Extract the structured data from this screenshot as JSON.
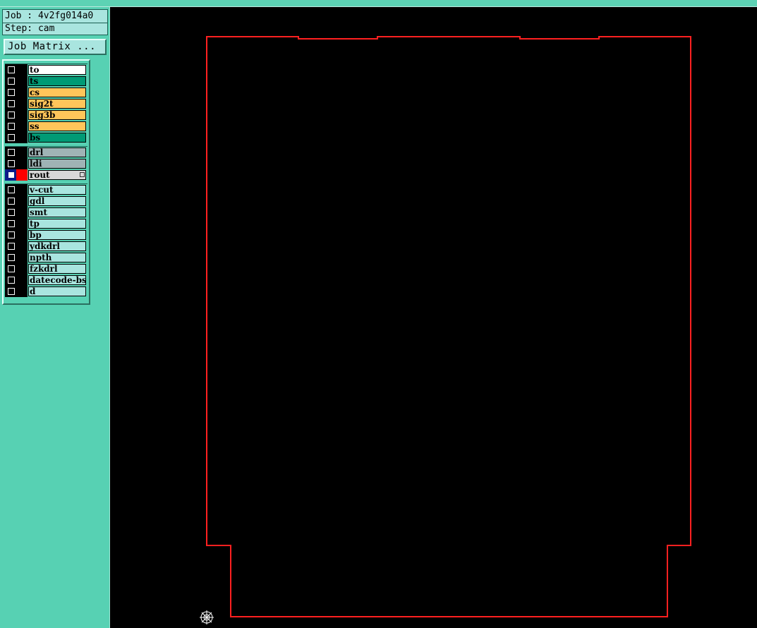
{
  "job": {
    "job_line": "Job : 4v2fg014a0",
    "step_line": "Step: cam"
  },
  "toolbar": {
    "job_matrix_label": "Job Matrix ..."
  },
  "layers": {
    "board": [
      {
        "name": "to",
        "color": "#ffffff"
      },
      {
        "name": "ts",
        "color": "#009a75"
      },
      {
        "name": "cs",
        "color": "#ffc55a"
      },
      {
        "name": "sig2t",
        "color": "#ffc55a"
      },
      {
        "name": "sig3b",
        "color": "#ffc55a"
      },
      {
        "name": "ss",
        "color": "#ffc55a"
      },
      {
        "name": "bs",
        "color": "#009a75"
      }
    ],
    "drill": [
      {
        "name": "drl",
        "color": "#9fb3b5"
      },
      {
        "name": "ldi",
        "color": "#9fb3b5"
      },
      {
        "name": "rout",
        "color": "#d8d8d8"
      }
    ],
    "misc": [
      {
        "name": "v-cut",
        "color": "#a9e5df"
      },
      {
        "name": "gdl",
        "color": "#a9e5df"
      },
      {
        "name": "smt",
        "color": "#a9e5df"
      },
      {
        "name": "tp",
        "color": "#a9e5df"
      },
      {
        "name": "bp",
        "color": "#a9e5df"
      },
      {
        "name": "ydkdrl",
        "color": "#a9e5df"
      },
      {
        "name": "npth",
        "color": "#a9e5df"
      },
      {
        "name": "fzkdrl",
        "color": "#a9e5df"
      },
      {
        "name": "datecode-bs",
        "color": "#a9e5df"
      },
      {
        "name": "d",
        "color": "#a9e5df"
      }
    ],
    "active_layer": "rout",
    "active_display_color": "#ff0000"
  },
  "canvas": {
    "background": "#000000",
    "outline_color": "#ff2020",
    "origin_marker_color": "#ffffff"
  }
}
